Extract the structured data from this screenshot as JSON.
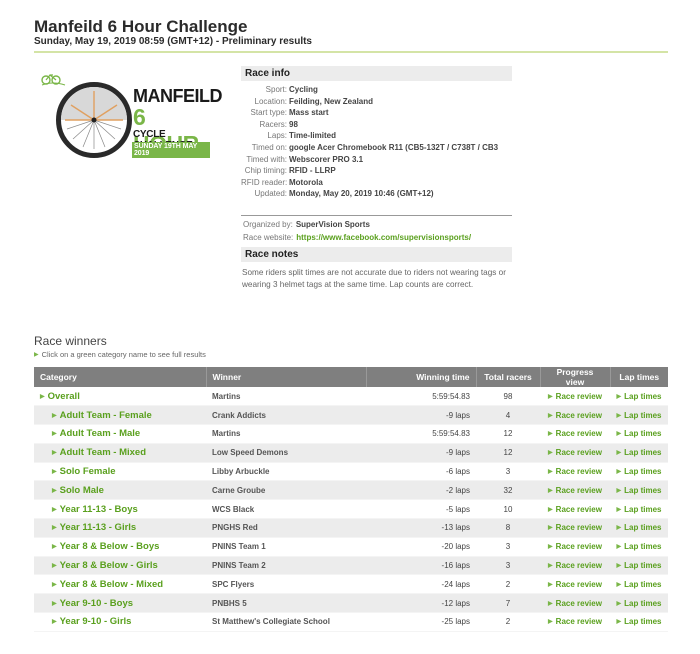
{
  "header": {
    "title": "Manfeild 6 Hour Challenge",
    "subtitle": "Sunday, May 19, 2019 08:59 (GMT+12) - Preliminary results"
  },
  "logo": {
    "line1": "MANFEILD",
    "line2": "6 HOUR",
    "line3": "CYCLE CHALLENGE",
    "line4": "SUNDAY 19TH MAY 2019"
  },
  "colors": {
    "accent_green": "#5aa01e",
    "header_rule": "#d4e4a6",
    "table_header": "#7f7f7f",
    "row_alt": "#ececec"
  },
  "race_info": {
    "heading": "Race info",
    "fields": [
      {
        "label": "Sport:",
        "value": "Cycling"
      },
      {
        "label": "Location:",
        "value": "Feilding, New Zealand"
      },
      {
        "label": "Start type:",
        "value": "Mass start"
      },
      {
        "label": "Racers:",
        "value": "98"
      },
      {
        "label": "Laps:",
        "value": "Time-limited"
      },
      {
        "label": "Timed on:",
        "value": "google Acer Chromebook R11 (CB5-132T / C738T / CB3"
      },
      {
        "label": "Timed with:",
        "value": "Webscorer PRO 3.1"
      },
      {
        "label": "Chip timing:",
        "value": "RFID - LLRP"
      },
      {
        "label": "RFID reader:",
        "value": "Motorola"
      },
      {
        "label": "Updated:",
        "value": "Monday, May 20, 2019 10:46 (GMT+12)"
      }
    ],
    "organized_by_label": "Organized by:",
    "organized_by": "SuperVision Sports",
    "website_label": "Race website:",
    "website": "https://www.facebook.com/supervisionsports/"
  },
  "race_notes": {
    "heading": "Race notes",
    "text": "Some riders split times are not accurate due to riders not wearing tags or wearing 3 helmet tags at the same time. Lap counts are correct."
  },
  "winners": {
    "title": "Race winners",
    "hint": "Click on a green category name to see full results",
    "columns": [
      "Category",
      "Winner",
      "Winning time",
      "Total racers",
      "Progress view",
      "Lap times"
    ],
    "rows": [
      {
        "category": "Overall",
        "sub": false,
        "winner": "Martins",
        "time": "5:59:54.83",
        "total": "98",
        "progress": "Race review",
        "laps": "Lap times"
      },
      {
        "category": "Adult Team - Female",
        "sub": true,
        "winner": "Crank Addicts",
        "time": "-9 laps",
        "total": "4",
        "progress": "Race review",
        "laps": "Lap times"
      },
      {
        "category": "Adult Team - Male",
        "sub": true,
        "winner": "Martins",
        "time": "5:59:54.83",
        "total": "12",
        "progress": "Race review",
        "laps": "Lap times"
      },
      {
        "category": "Adult Team - Mixed",
        "sub": true,
        "winner": "Low Speed Demons",
        "time": "-9 laps",
        "total": "12",
        "progress": "Race review",
        "laps": "Lap times"
      },
      {
        "category": "Solo Female",
        "sub": true,
        "winner": "Libby Arbuckle",
        "time": "-6 laps",
        "total": "3",
        "progress": "Race review",
        "laps": "Lap times"
      },
      {
        "category": "Solo Male",
        "sub": true,
        "winner": "Carne Groube",
        "time": "-2 laps",
        "total": "32",
        "progress": "Race review",
        "laps": "Lap times"
      },
      {
        "category": "Year 11-13 - Boys",
        "sub": true,
        "winner": "WCS Black",
        "time": "-5 laps",
        "total": "10",
        "progress": "Race review",
        "laps": "Lap times"
      },
      {
        "category": "Year 11-13 - Girls",
        "sub": true,
        "winner": "PNGHS Red",
        "time": "-13 laps",
        "total": "8",
        "progress": "Race review",
        "laps": "Lap times"
      },
      {
        "category": "Year 8 & Below - Boys",
        "sub": true,
        "winner": "PNINS Team 1",
        "time": "-20 laps",
        "total": "3",
        "progress": "Race review",
        "laps": "Lap times"
      },
      {
        "category": "Year 8 & Below - Girls",
        "sub": true,
        "winner": "PNINS Team 2",
        "time": "-16 laps",
        "total": "3",
        "progress": "Race review",
        "laps": "Lap times"
      },
      {
        "category": "Year 8 & Below - Mixed",
        "sub": true,
        "winner": "SPC Flyers",
        "time": "-24 laps",
        "total": "2",
        "progress": "Race review",
        "laps": "Lap times"
      },
      {
        "category": "Year 9-10 - Boys",
        "sub": true,
        "winner": "PNBHS 5",
        "time": "-12 laps",
        "total": "7",
        "progress": "Race review",
        "laps": "Lap times"
      },
      {
        "category": "Year 9-10 - Girls",
        "sub": true,
        "winner": "St Matthew's Collegiate School",
        "time": "-25 laps",
        "total": "2",
        "progress": "Race review",
        "laps": "Lap times"
      }
    ]
  }
}
